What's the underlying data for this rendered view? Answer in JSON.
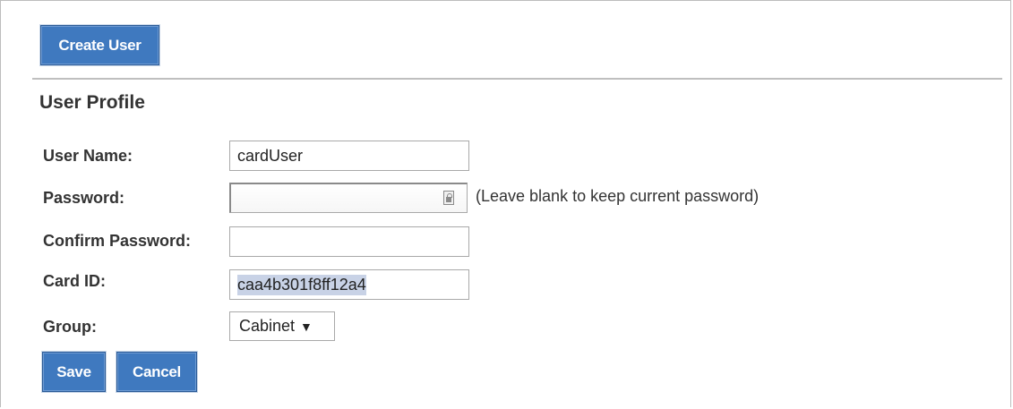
{
  "toolbar": {
    "create_user_label": "Create User"
  },
  "section": {
    "title": "User Profile"
  },
  "form": {
    "username": {
      "label": "User Name:",
      "value": "cardUser"
    },
    "password": {
      "label": "Password:",
      "value": "",
      "hint": "(Leave blank to keep current password)"
    },
    "confirm_password": {
      "label": "Confirm Password:",
      "value": ""
    },
    "card_id": {
      "label": "Card ID:",
      "value": "caa4b301f8ff12a4"
    },
    "group": {
      "label": "Group:",
      "selected": "Cabinet",
      "arrow": "▼"
    }
  },
  "actions": {
    "save_label": "Save",
    "cancel_label": "Cancel"
  },
  "colors": {
    "button_bg": "#3f79bf",
    "divider": "#bfbfbf"
  },
  "icons": {
    "password_field_icon": "password-lock-icon"
  }
}
